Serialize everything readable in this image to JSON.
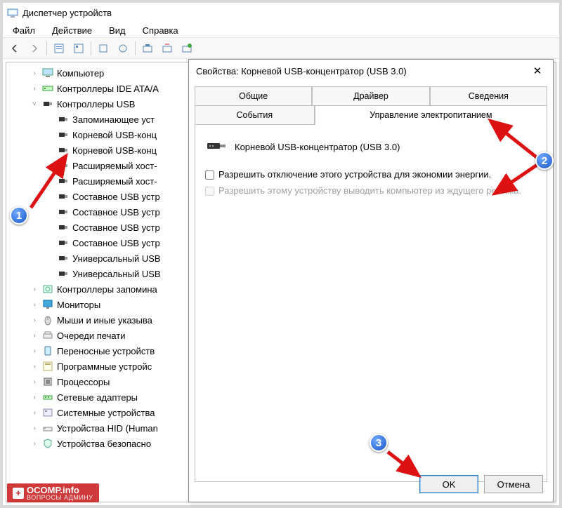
{
  "window": {
    "title": "Диспетчер устройств"
  },
  "menu": {
    "file": "Файл",
    "action": "Действие",
    "view": "Вид",
    "help": "Справка"
  },
  "tree": {
    "items": [
      {
        "indent": 1,
        "expander": "›",
        "icon": "computer",
        "label": "Компьютер"
      },
      {
        "indent": 1,
        "expander": "›",
        "icon": "ide",
        "label": "Контроллеры IDE ATA/A"
      },
      {
        "indent": 1,
        "expander": "˅",
        "icon": "usb",
        "label": "Контроллеры USB"
      },
      {
        "indent": 2,
        "expander": "",
        "icon": "usb",
        "label": "Запоминающее уст"
      },
      {
        "indent": 2,
        "expander": "",
        "icon": "usb",
        "label": "Корневой USB-конц"
      },
      {
        "indent": 2,
        "expander": "",
        "icon": "usb",
        "label": "Корневой USB-конц"
      },
      {
        "indent": 2,
        "expander": "",
        "icon": "usb",
        "label": "Расширяемый хост-"
      },
      {
        "indent": 2,
        "expander": "",
        "icon": "usb",
        "label": "Расширяемый хост-"
      },
      {
        "indent": 2,
        "expander": "",
        "icon": "usb",
        "label": "Составное USB устр"
      },
      {
        "indent": 2,
        "expander": "",
        "icon": "usb",
        "label": "Составное USB устр"
      },
      {
        "indent": 2,
        "expander": "",
        "icon": "usb",
        "label": "Составное USB устр"
      },
      {
        "indent": 2,
        "expander": "",
        "icon": "usb",
        "label": "Составное USB устр"
      },
      {
        "indent": 2,
        "expander": "",
        "icon": "usb",
        "label": "Универсальный USB"
      },
      {
        "indent": 2,
        "expander": "",
        "icon": "usb",
        "label": "Универсальный USB"
      },
      {
        "indent": 1,
        "expander": "›",
        "icon": "storage",
        "label": "Контроллеры запомина"
      },
      {
        "indent": 1,
        "expander": "›",
        "icon": "monitor",
        "label": "Мониторы"
      },
      {
        "indent": 1,
        "expander": "›",
        "icon": "mouse",
        "label": "Мыши и иные указыва"
      },
      {
        "indent": 1,
        "expander": "›",
        "icon": "queue",
        "label": "Очереди печати"
      },
      {
        "indent": 1,
        "expander": "›",
        "icon": "portable",
        "label": "Переносные устройств"
      },
      {
        "indent": 1,
        "expander": "›",
        "icon": "software",
        "label": "Программные устройс"
      },
      {
        "indent": 1,
        "expander": "›",
        "icon": "cpu",
        "label": "Процессоры"
      },
      {
        "indent": 1,
        "expander": "›",
        "icon": "network",
        "label": "Сетевые адаптеры"
      },
      {
        "indent": 1,
        "expander": "›",
        "icon": "system",
        "label": "Системные устройства"
      },
      {
        "indent": 1,
        "expander": "›",
        "icon": "hid",
        "label": "Устройства HID (Human"
      },
      {
        "indent": 1,
        "expander": "›",
        "icon": "security",
        "label": "Устройства безопасно"
      }
    ]
  },
  "dialog": {
    "title": "Свойства: Корневой USB-концентратор (USB 3.0)",
    "tabs": {
      "general": "Общие",
      "driver": "Драйвер",
      "details": "Сведения",
      "events": "События",
      "power": "Управление электропитанием"
    },
    "device_name": "Корневой USB-концентратор (USB 3.0)",
    "checkbox1": "Разрешить отключение этого устройства для экономии энергии.",
    "checkbox2": "Разрешить этому устройству выводить компьютер из ждущего режима.",
    "ok": "OK",
    "cancel": "Отмена"
  },
  "markers": {
    "m1": "1",
    "m2": "2",
    "m3": "3"
  },
  "watermark": {
    "main": "OCOMP.info",
    "sub": "ВОПРОСЫ АДМИНУ"
  }
}
